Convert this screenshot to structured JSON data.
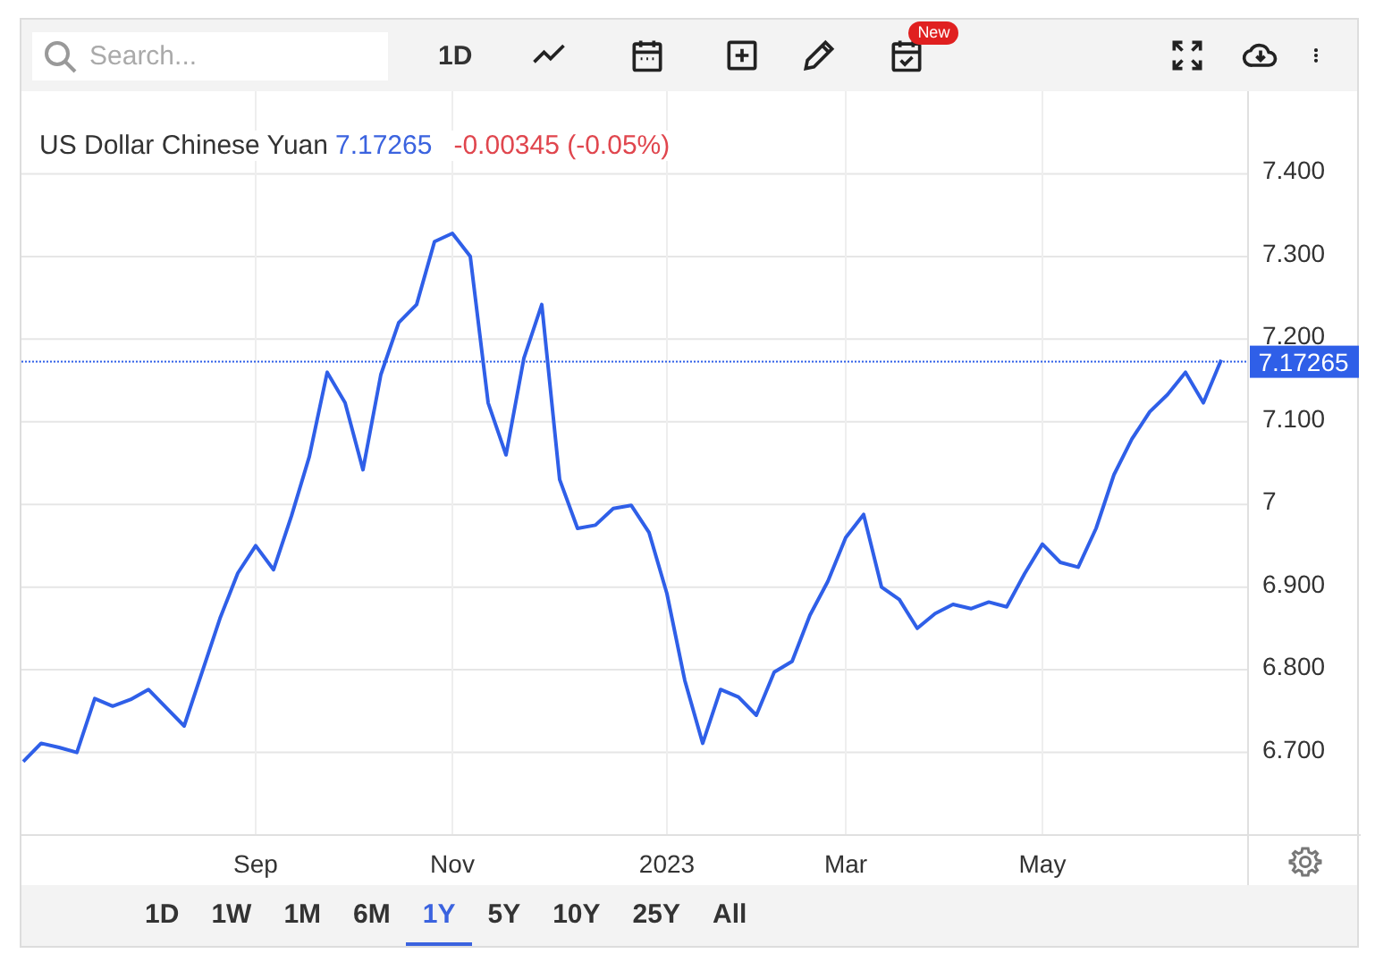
{
  "toolbar": {
    "search": {
      "placeholder": "Search..."
    },
    "interval": "1D",
    "badge": "New"
  },
  "quote": {
    "price": "7.17265",
    "change": "-0.00345 (-0.05%)"
  },
  "chart_data": {
    "type": "line",
    "grid": true,
    "ref_lines": [
      {
        "axis": "y",
        "value": 7.17265,
        "label": "7.17265"
      }
    ],
    "categories": [
      null,
      null,
      null,
      null,
      null,
      null,
      null,
      null,
      null,
      null,
      null,
      null,
      null,
      "Sep",
      null,
      null,
      null,
      null,
      null,
      null,
      null,
      null,
      null,
      null,
      "Nov",
      null,
      null,
      null,
      null,
      null,
      null,
      null,
      null,
      null,
      null,
      null,
      "2023",
      null,
      null,
      null,
      null,
      null,
      null,
      null,
      null,
      null,
      "Mar",
      null,
      null,
      null,
      null,
      null,
      null,
      null,
      null,
      null,
      null,
      "May",
      null,
      null,
      null,
      null,
      null,
      null,
      null,
      null,
      null,
      null
    ],
    "series": [
      {
        "name": "US Dollar Chinese Yuan",
        "color": "#2f5fe8",
        "values": [
          6.689,
          6.711,
          6.706,
          6.7,
          6.765,
          6.756,
          6.764,
          6.776,
          6.754,
          6.732,
          6.797,
          6.862,
          6.917,
          6.95,
          6.921,
          6.986,
          7.058,
          7.16,
          7.123,
          7.042,
          7.157,
          7.22,
          7.242,
          7.318,
          7.328,
          7.3,
          7.123,
          7.06,
          7.177,
          7.242,
          7.03,
          6.971,
          6.975,
          6.995,
          6.999,
          6.966,
          6.892,
          6.787,
          6.711,
          6.776,
          6.767,
          6.745,
          6.797,
          6.81,
          6.866,
          6.907,
          6.96,
          6.988,
          6.9,
          6.885,
          6.85,
          6.868,
          6.879,
          6.874,
          6.882,
          6.876,
          6.916,
          6.952,
          6.93,
          6.924,
          6.971,
          7.036,
          7.079,
          7.112,
          7.133,
          7.16,
          7.123,
          7.175
        ]
      }
    ],
    "ylim": [
      6.6,
      7.5
    ],
    "yticks": [
      {
        "value": 6.7,
        "label": "6.700"
      },
      {
        "value": 6.8,
        "label": "6.800"
      },
      {
        "value": 6.9,
        "label": "6.900"
      },
      {
        "value": 7,
        "label": "7"
      },
      {
        "value": 7.1,
        "label": "7.100"
      },
      {
        "value": 7.2,
        "label": "7.200"
      },
      {
        "value": 7.3,
        "label": "7.300"
      },
      {
        "value": 7.4,
        "label": "7.400"
      }
    ]
  },
  "ranges": [
    {
      "label": "1D",
      "selected": false
    },
    {
      "label": "1W",
      "selected": false
    },
    {
      "label": "1M",
      "selected": false
    },
    {
      "label": "6M",
      "selected": false
    },
    {
      "label": "1Y",
      "selected": true
    },
    {
      "label": "5Y",
      "selected": false
    },
    {
      "label": "10Y",
      "selected": false
    },
    {
      "label": "25Y",
      "selected": false
    },
    {
      "label": "All",
      "selected": false
    }
  ]
}
